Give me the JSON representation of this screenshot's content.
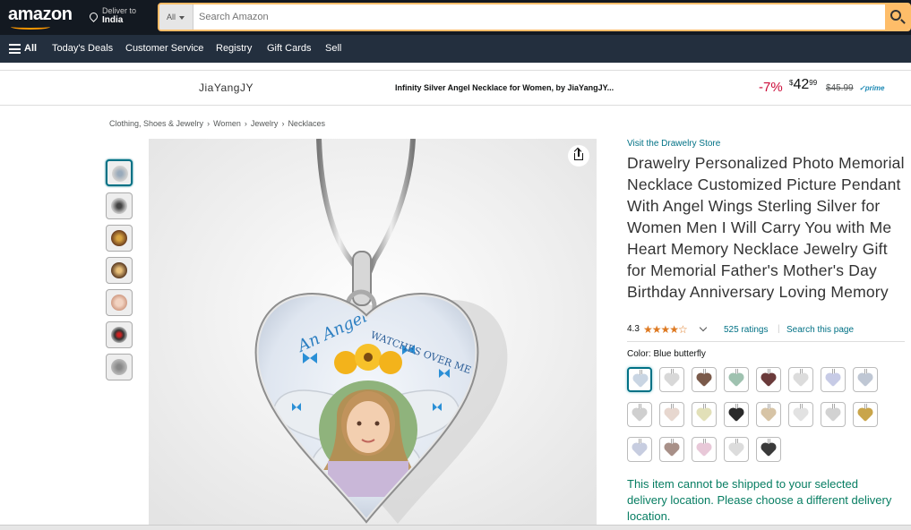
{
  "header": {
    "logo": "amazon",
    "deliver_line1": "Deliver to",
    "deliver_line2": "India",
    "search_category": "All",
    "search_placeholder": "Search Amazon"
  },
  "nav": {
    "all": "All",
    "items": [
      "Today's Deals",
      "Customer Service",
      "Registry",
      "Gift Cards",
      "Sell"
    ]
  },
  "strip": {
    "brand": "JiaYangJY",
    "title": "Infinity Silver Angel Necklace for Women, by JiaYangJY...",
    "discount": "-7%",
    "price_currency": "$",
    "price_whole": "42",
    "price_fraction": "99",
    "old_price": "$45.99",
    "prime": "prime"
  },
  "breadcrumb": [
    "Clothing, Shoes & Jewelry",
    "Women",
    "Jewelry",
    "Necklaces"
  ],
  "breadcrumb_sep": "›",
  "product": {
    "store_link": "Visit the Drawelry Store",
    "title": "Drawelry Personalized Photo Memorial Necklace Customized Picture Pendant With Angel Wings Sterling Silver for Women Men I Will Carry You with Me Heart Memory Necklace Jewelry Gift for Memorial Father's Mother's Day Birthday Anniversary Loving Memory",
    "rating_value": "4.3",
    "stars": "★★★★☆",
    "ratings_count": "525 ratings",
    "rating_pipe": "|",
    "search_page": "Search this page",
    "color_label": "Color:",
    "color_value": "Blue butterfly",
    "shipping_notice": "This item cannot be shipped to your selected delivery location. Please choose a different delivery location."
  },
  "pendant": {
    "text_angel": "An Angel",
    "text_watches": "WATCHES OVER ME"
  },
  "colors": {
    "accent": "#007185",
    "price_red": "#cc0c39",
    "star": "#de7921",
    "ship_green": "#067d62",
    "nav_dark": "#131921",
    "nav_secondary": "#232f3e"
  }
}
